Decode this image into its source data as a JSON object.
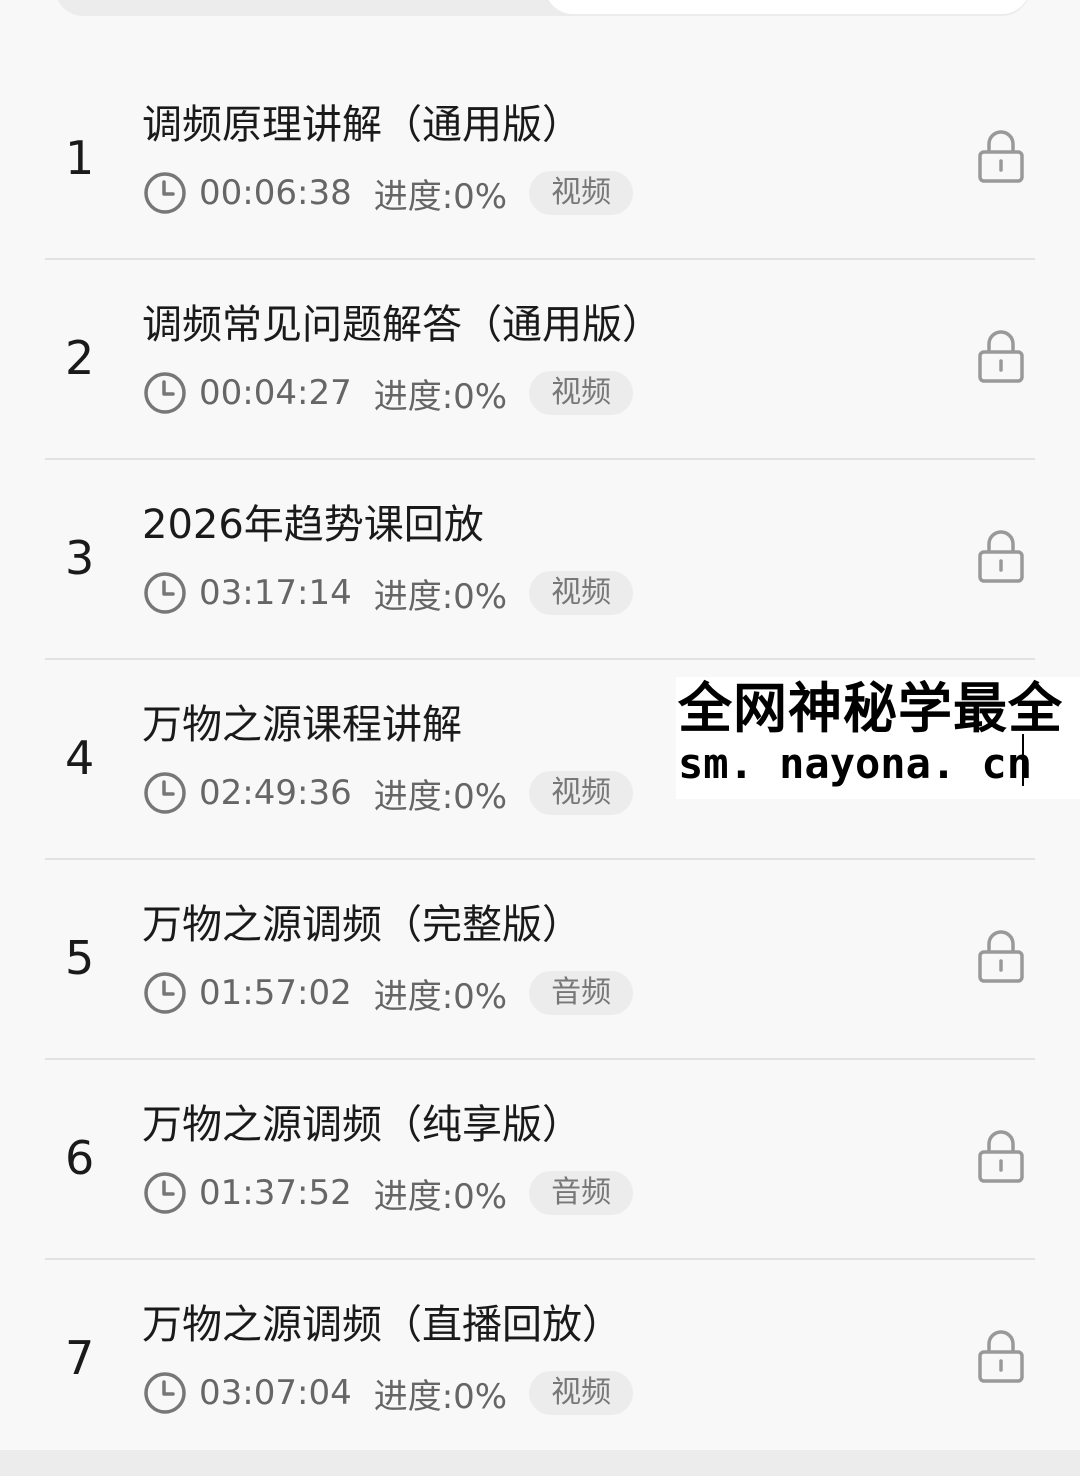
{
  "lessons": [
    {
      "index": "1",
      "title": "调频原理讲解（通用版）",
      "duration": "00:06:38",
      "progress": "进度:0%",
      "type": "视频"
    },
    {
      "index": "2",
      "title": "调频常见问题解答（通用版）",
      "duration": "00:04:27",
      "progress": "进度:0%",
      "type": "视频"
    },
    {
      "index": "3",
      "title": "2026年趋势课回放",
      "duration": "03:17:14",
      "progress": "进度:0%",
      "type": "视频"
    },
    {
      "index": "4",
      "title": "万物之源课程讲解",
      "duration": "02:49:36",
      "progress": "进度:0%",
      "type": "视频"
    },
    {
      "index": "5",
      "title": "万物之源调频（完整版）",
      "duration": "01:57:02",
      "progress": "进度:0%",
      "type": "音频"
    },
    {
      "index": "6",
      "title": "万物之源调频（纯享版）",
      "duration": "01:37:52",
      "progress": "进度:0%",
      "type": "音频"
    },
    {
      "index": "7",
      "title": "万物之源调频（直播回放）",
      "duration": "03:07:04",
      "progress": "进度:0%",
      "type": "视频"
    }
  ],
  "watermark": {
    "line1": "全网神秘学最全",
    "line2": "sm. nayona. cn"
  },
  "icons": {
    "duration": "clock-icon",
    "locked": "lock-icon"
  }
}
